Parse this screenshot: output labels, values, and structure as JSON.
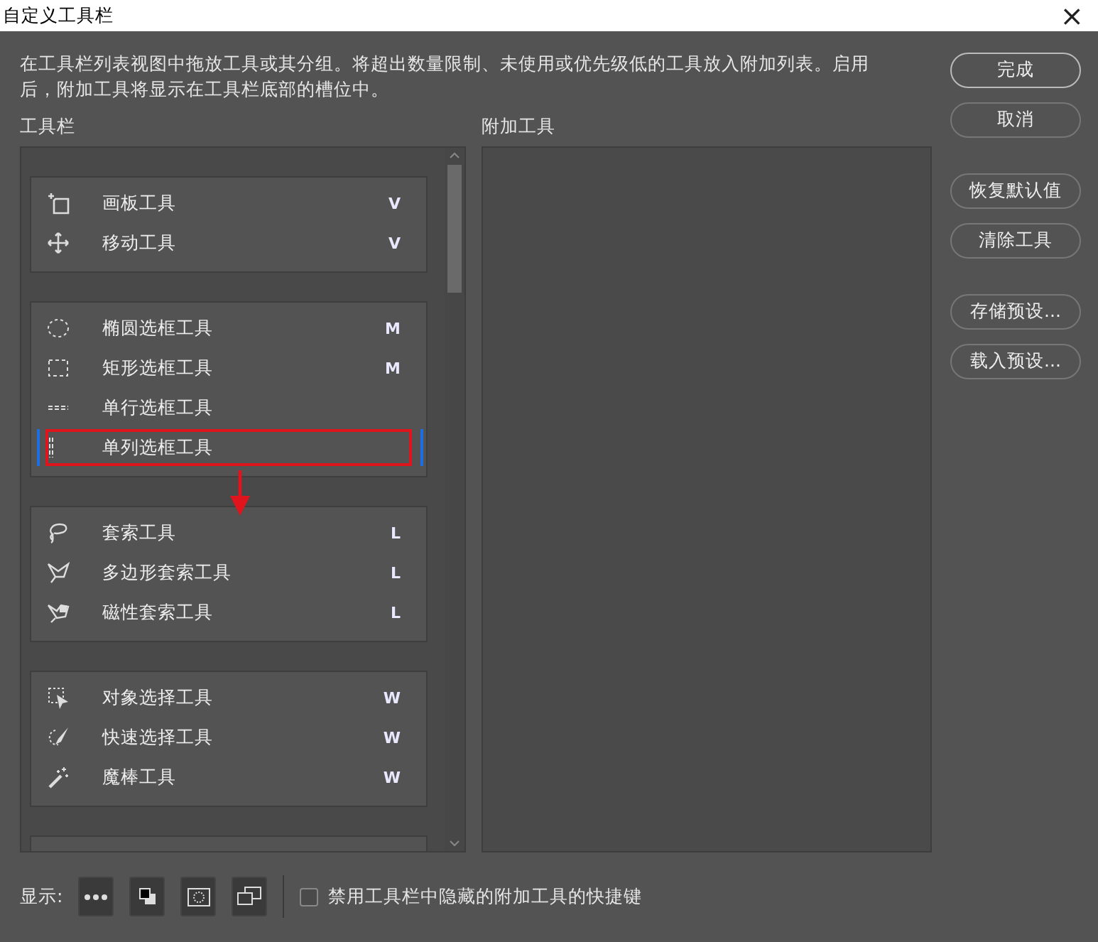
{
  "window": {
    "title": "自定义工具栏",
    "close": "×"
  },
  "description": "在工具栏列表视图中拖放工具或其分组。将超出数量限制、未使用或优先级低的工具放入附加列表。启用后，附加工具将显示在工具栏底部的槽位中。",
  "toolbar_list": {
    "heading": "工具栏",
    "groups": [
      {
        "tools": [
          {
            "name": "画板工具",
            "shortcut": "V",
            "marked": false
          },
          {
            "name": "移动工具",
            "shortcut": "V",
            "marked": false
          }
        ]
      },
      {
        "tools": [
          {
            "name": "椭圆选框工具",
            "shortcut": "M",
            "marked": false
          },
          {
            "name": "矩形选框工具",
            "shortcut": "M",
            "marked": false
          },
          {
            "name": "单行选框工具",
            "marked": false
          },
          {
            "name": "单列选框工具",
            "marked": true
          }
        ]
      },
      {
        "tools": [
          {
            "name": "套索工具",
            "shortcut": "L",
            "marked": false
          },
          {
            "name": "多边形套索工具",
            "shortcut": "L",
            "marked": false
          },
          {
            "name": "磁性套索工具",
            "shortcut": "L",
            "marked": false
          }
        ]
      },
      {
        "tools": [
          {
            "name": "对象选择工具",
            "shortcut": "W",
            "marked": false
          },
          {
            "name": "快速选择工具",
            "shortcut": "W",
            "marked": false
          },
          {
            "name": "魔棒工具",
            "shortcut": "W",
            "marked": false
          }
        ]
      }
    ]
  },
  "extra_tools": {
    "heading": "附加工具"
  },
  "buttons": [
    {
      "label": "完成",
      "primary": true
    },
    {
      "label": "取消",
      "primary": false
    },
    {
      "label": "恢复默认值",
      "primary": false
    },
    {
      "label": "清除工具",
      "primary": false
    },
    {
      "label": "存储预设...",
      "primary": false
    },
    {
      "label": "载入预设...",
      "primary": false
    }
  ],
  "footer": {
    "show_label": "显示:",
    "checkbox": {
      "label": "禁用工具栏中隐藏的附加工具的快捷键",
      "checked": false
    }
  }
}
